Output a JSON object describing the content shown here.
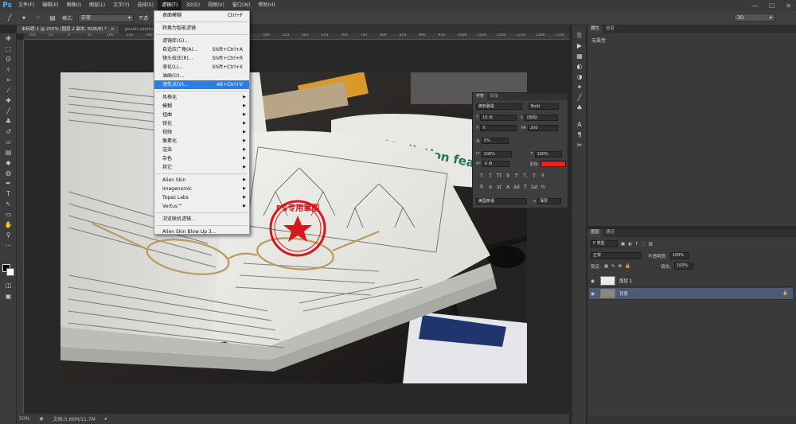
{
  "app": {
    "logo": "Ps"
  },
  "menubar": {
    "items": [
      "文件(F)",
      "编辑(E)",
      "图像(I)",
      "图层(L)",
      "文字(Y)",
      "选择(S)",
      "滤镜(T)",
      "3D(D)",
      "视图(V)",
      "窗口(W)",
      "帮助(H)"
    ],
    "active_index": 6
  },
  "window_controls": {
    "minimize": "—",
    "restore": "☐",
    "close": "✕"
  },
  "options_bar": {
    "mode_label": "模式:",
    "mode_value": "正常",
    "opacity_label": "不透",
    "workspace_value": "3D"
  },
  "tabs": [
    {
      "label": "未标题-1 @ 250% (图层 2 副本, RGB/8) *",
      "close": "×",
      "active": true
    },
    {
      "label": "pexels-photo",
      "close": "",
      "active": false
    }
  ],
  "rulers": {
    "top_labels": [
      "100",
      "50",
      "0",
      "50",
      "100",
      "150",
      "200",
      "250",
      "300",
      "350",
      "400",
      "450",
      "500",
      "550",
      "600",
      "650",
      "700",
      "750",
      "800",
      "850",
      "900",
      "950",
      "1000",
      "1050",
      "1100",
      "1150",
      "1200",
      "1250"
    ]
  },
  "filter_menu": {
    "items": [
      {
        "label": "表面模糊",
        "shortcut": "Ctrl+F",
        "sub": false,
        "sep_after": true
      },
      {
        "label": "转换为智能滤镜",
        "shortcut": "",
        "sub": false,
        "sep_after": true
      },
      {
        "label": "滤镜库(G)...",
        "shortcut": "",
        "sub": false,
        "sep_after": false
      },
      {
        "label": "自适应广角(A)...",
        "shortcut": "Shift+Ctrl+A",
        "sub": false,
        "sep_after": false
      },
      {
        "label": "镜头校正(R)...",
        "shortcut": "Shift+Ctrl+R",
        "sub": false,
        "sep_after": false
      },
      {
        "label": "液化(L)...",
        "shortcut": "Shift+Ctrl+X",
        "sub": false,
        "sep_after": false
      },
      {
        "label": "油画(O)...",
        "shortcut": "",
        "sub": false,
        "sep_after": false
      },
      {
        "label": "消失点(V)...",
        "shortcut": "Alt+Ctrl+V",
        "sub": false,
        "sep_after": true,
        "highlight": true
      },
      {
        "label": "风格化",
        "shortcut": "",
        "sub": true,
        "sep_after": false
      },
      {
        "label": "模糊",
        "shortcut": "",
        "sub": true,
        "sep_after": false
      },
      {
        "label": "扭曲",
        "shortcut": "",
        "sub": true,
        "sep_after": false
      },
      {
        "label": "锐化",
        "shortcut": "",
        "sub": true,
        "sep_after": false
      },
      {
        "label": "视频",
        "shortcut": "",
        "sub": true,
        "sep_after": false
      },
      {
        "label": "像素化",
        "shortcut": "",
        "sub": true,
        "sep_after": false
      },
      {
        "label": "渲染",
        "shortcut": "",
        "sub": true,
        "sep_after": false
      },
      {
        "label": "杂色",
        "shortcut": "",
        "sub": true,
        "sep_after": false
      },
      {
        "label": "其它",
        "shortcut": "",
        "sub": true,
        "sep_after": true
      },
      {
        "label": "Alien Skin",
        "shortcut": "",
        "sub": true,
        "sep_after": false
      },
      {
        "label": "Imagenomic",
        "shortcut": "",
        "sub": true,
        "sep_after": false
      },
      {
        "label": "Topaz Labs",
        "shortcut": "",
        "sub": true,
        "sep_after": false
      },
      {
        "label": "Vertus™",
        "shortcut": "",
        "sub": true,
        "sep_after": true
      },
      {
        "label": "浏览联机滤镜...",
        "shortcut": "",
        "sub": false,
        "sep_after": true
      },
      {
        "label": "Alien Skin Blow Up 3...",
        "shortcut": "",
        "sub": false,
        "sep_after": false
      }
    ]
  },
  "character_panel": {
    "tabs": [
      "字符",
      "段落"
    ],
    "font_family": "微软雅黑",
    "font_style": "Bold",
    "size": "10 点",
    "leading": "(自动)",
    "kerning": "0",
    "tracking": "200",
    "scale_label_pct": "0%",
    "vscale": "100%",
    "hscale": "100%",
    "baseline": "0 点",
    "color_label": "颜色:",
    "text_color": "#ff1a1a",
    "style_buttons": [
      "T",
      "T",
      "TT",
      "Tr",
      "T'",
      "T,",
      "T",
      "Ŧ"
    ],
    "ot_buttons": [
      "fi",
      "σ",
      "st",
      "A",
      "ād",
      "T",
      "1st",
      "½"
    ],
    "language": "美国英语",
    "aa_label": "a",
    "aa": "浑厚"
  },
  "properties_panel": {
    "tabs": [
      "属性",
      "信息"
    ],
    "empty_text": "无属性"
  },
  "layers_panel": {
    "tabs": [
      "图层",
      "通道"
    ],
    "filter_label": "P 类型",
    "blend_mode": "正常",
    "opacity_label": "不透明度:",
    "opacity": "100%",
    "lock_label": "锁定:",
    "fill_label": "填充:",
    "fill": "100%",
    "layers": [
      {
        "name": "图层 1",
        "selected": false,
        "locked": false
      },
      {
        "name": "背景",
        "selected": true,
        "locked": true
      }
    ]
  },
  "status_bar": {
    "zoom": "50%",
    "doc_info": "文档:5.66M/11.7M"
  },
  "photo": {
    "title_text": "Mediation fea",
    "stamp_text": "PS专用章图",
    "stamp_color": "#d9161b"
  },
  "colors": {
    "accent": "#2c7fe0",
    "selected_layer": "#4e5a74",
    "panel_bg": "#3a3a3a"
  }
}
